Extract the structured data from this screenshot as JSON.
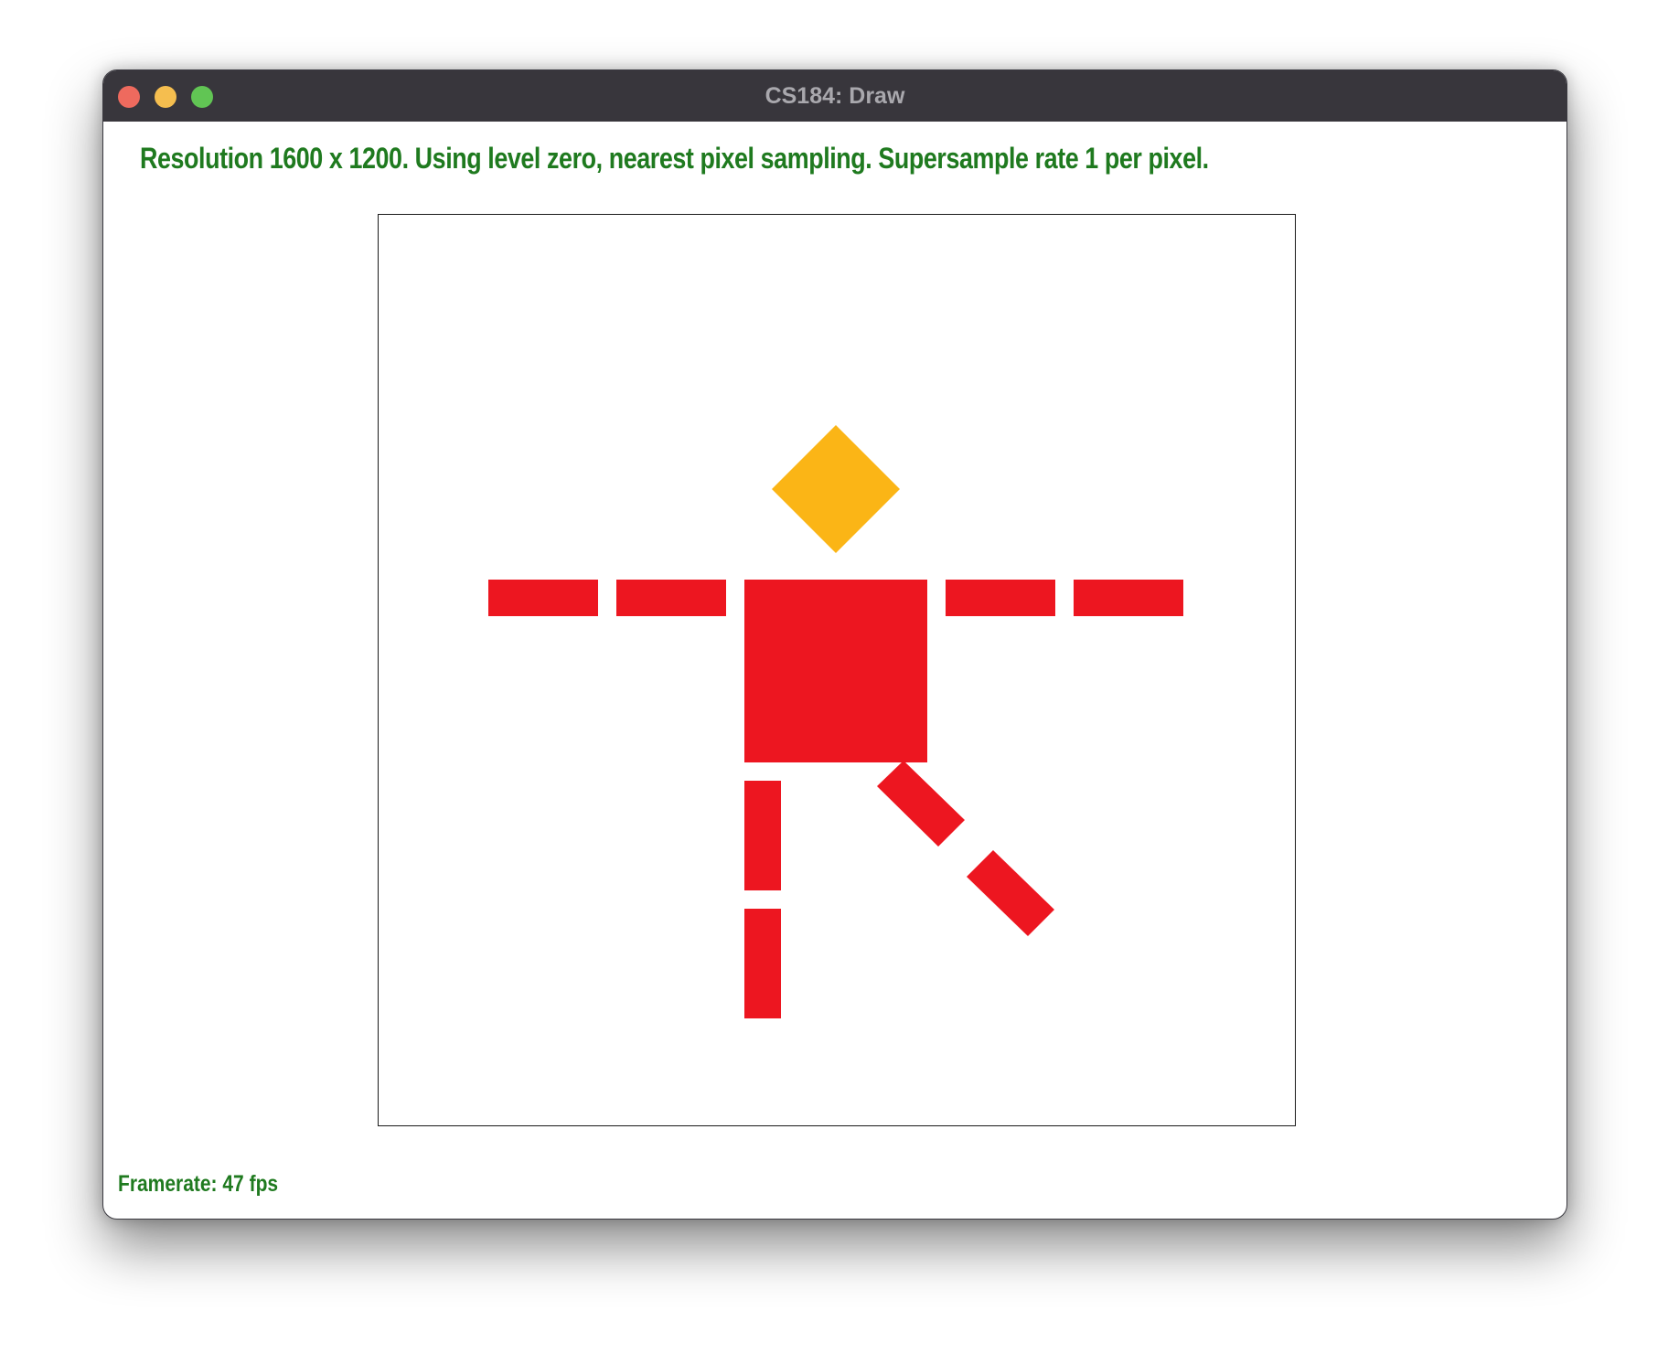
{
  "window": {
    "title": "CS184: Draw"
  },
  "status": {
    "text": "Resolution 1600 x 1200. Using level zero, nearest pixel sampling. Supersample rate 1 per pixel."
  },
  "footer": {
    "framerate": "Framerate: 47 fps"
  },
  "colors": {
    "text_green": "#1f7a1f",
    "figure_red": "#ed1620",
    "head_yellow": "#fbb516",
    "titlebar": "#38363c"
  },
  "drawing": {
    "subject": "stick-figure",
    "head_color": "#fbb516",
    "body_color": "#ed1620"
  }
}
